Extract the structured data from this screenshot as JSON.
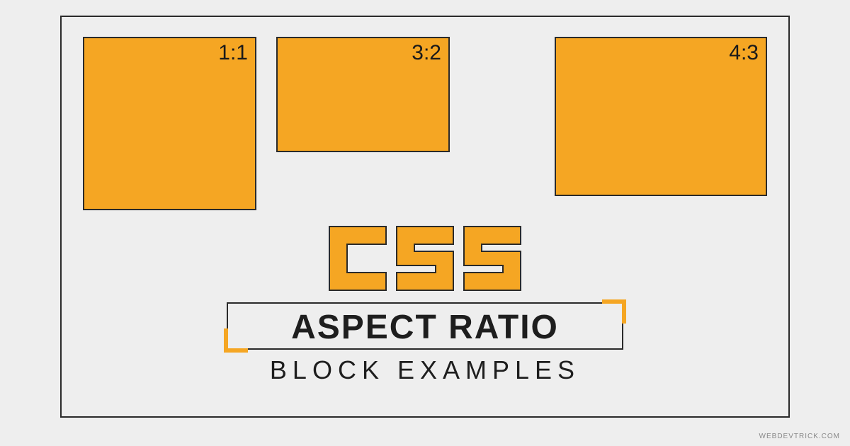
{
  "boxes": [
    {
      "label": "1:1"
    },
    {
      "label": "3:2"
    },
    {
      "label": "4:3"
    }
  ],
  "logo_text": "CSS",
  "title": "ASPECT RATIO",
  "subtitle": "BLOCK EXAMPLES",
  "watermark": "WEBDEVTRICK.COM",
  "colors": {
    "accent": "#f5a623",
    "border": "#2a2a2a",
    "bg": "#eeeeee"
  }
}
